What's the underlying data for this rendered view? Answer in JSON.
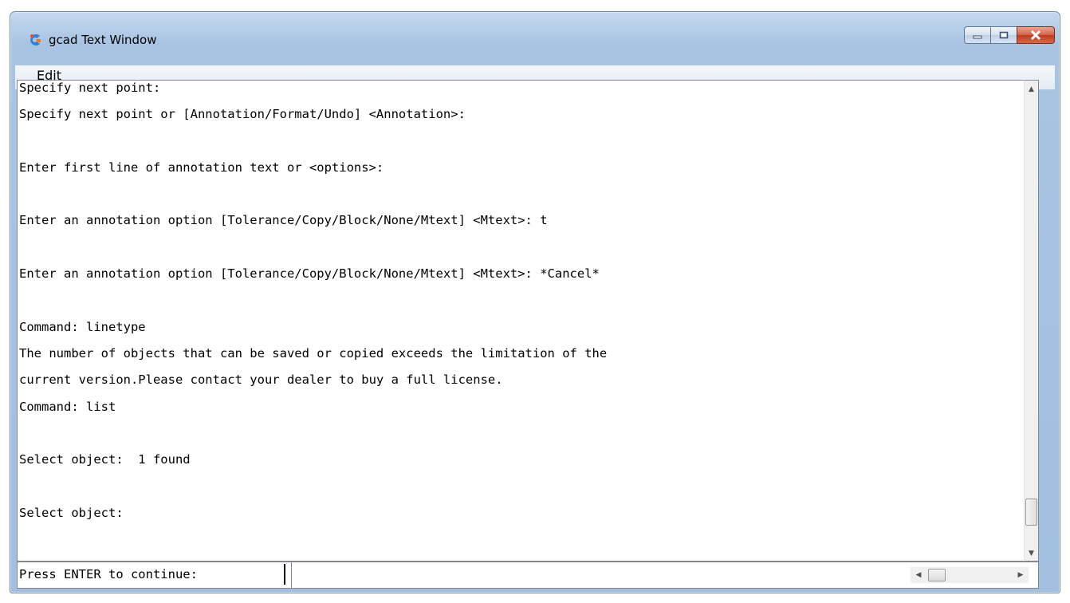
{
  "window": {
    "title": "gcad Text Window",
    "icon": "gcad-app-icon",
    "controls": [
      "minimize-icon",
      "maximize-icon",
      "close-icon"
    ]
  },
  "menu": {
    "items": [
      "Edit"
    ]
  },
  "console": {
    "lines": [
      "Specify next point:",
      "Specify next point or [Annotation/Format/Undo] <Annotation>:",
      "",
      "Enter first line of annotation text or <options>:",
      "",
      "Enter an annotation option [Tolerance/Copy/Block/None/Mtext] <Mtext>: t",
      "",
      "Enter an annotation option [Tolerance/Copy/Block/None/Mtext] <Mtext>: *Cancel*",
      "",
      "Command: linetype",
      "The number of objects that can be saved or copied exceeds the limitation of the",
      "current version.Please contact your dealer to buy a full license.",
      "Command: list",
      "",
      "Select object:  1 found",
      "",
      "Select object:"
    ]
  },
  "input": {
    "prompt": "Press ENTER to continue:",
    "value": ""
  },
  "colors": {
    "title_bar": "#a9c4e3",
    "close_button": "#c03a1f",
    "background": "#ffffff"
  }
}
